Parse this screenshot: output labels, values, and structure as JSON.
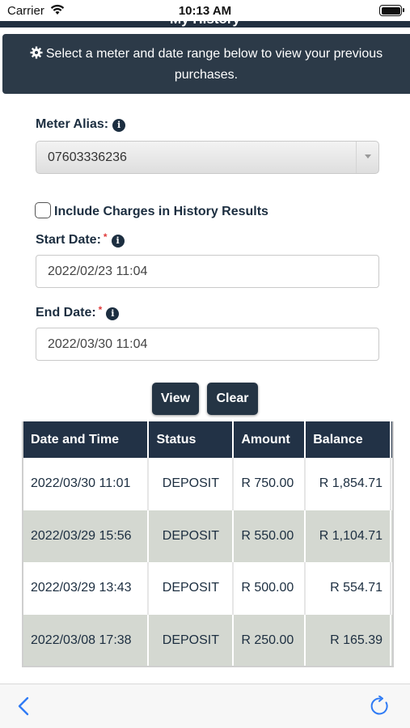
{
  "status_bar": {
    "carrier": "Carrier",
    "time": "10:13 AM"
  },
  "header": {
    "title": "My History"
  },
  "banner": {
    "text": "Select a meter and date range below to view your previous purchases."
  },
  "form": {
    "meter_label": "Meter Alias:",
    "meter_value": "07603336236",
    "include_charges_label": "Include Charges in History Results",
    "include_charges_checked": false,
    "start_label": "Start Date:",
    "start_value": "2022/02/23 11:04",
    "end_label": "End Date:",
    "end_value": "2022/03/30 11:04",
    "required_mark": "*",
    "info_glyph": "i"
  },
  "buttons": {
    "view": "View",
    "clear": "Clear"
  },
  "table": {
    "headers": [
      "Date and Time",
      "Status",
      "Amount",
      "Balance"
    ],
    "rows": [
      {
        "datetime": "2022/03/30 11:01",
        "status": "DEPOSIT",
        "amount": "R 750.00",
        "balance": "R 1,854.71"
      },
      {
        "datetime": "2022/03/29 15:56",
        "status": "DEPOSIT",
        "amount": "R 550.00",
        "balance": "R 1,104.71"
      },
      {
        "datetime": "2022/03/29 13:43",
        "status": "DEPOSIT",
        "amount": "R 500.00",
        "balance": "R 554.71"
      },
      {
        "datetime": "2022/03/08 17:38",
        "status": "DEPOSIT",
        "amount": "R 250.00",
        "balance": "R 165.39"
      }
    ]
  },
  "icons": {
    "gear": "gear-icon",
    "info": "info-icon",
    "back": "chevron-left-icon",
    "refresh": "refresh-icon",
    "wifi": "wifi-icon",
    "battery": "battery-icon"
  },
  "colors": {
    "header_bg": "#223246",
    "banner_bg": "#2c3a48",
    "button_bg": "#243444",
    "row_alt": "#d4d8d1",
    "required": "#e03b3b",
    "toolbar_icon": "#2f7bf5"
  }
}
